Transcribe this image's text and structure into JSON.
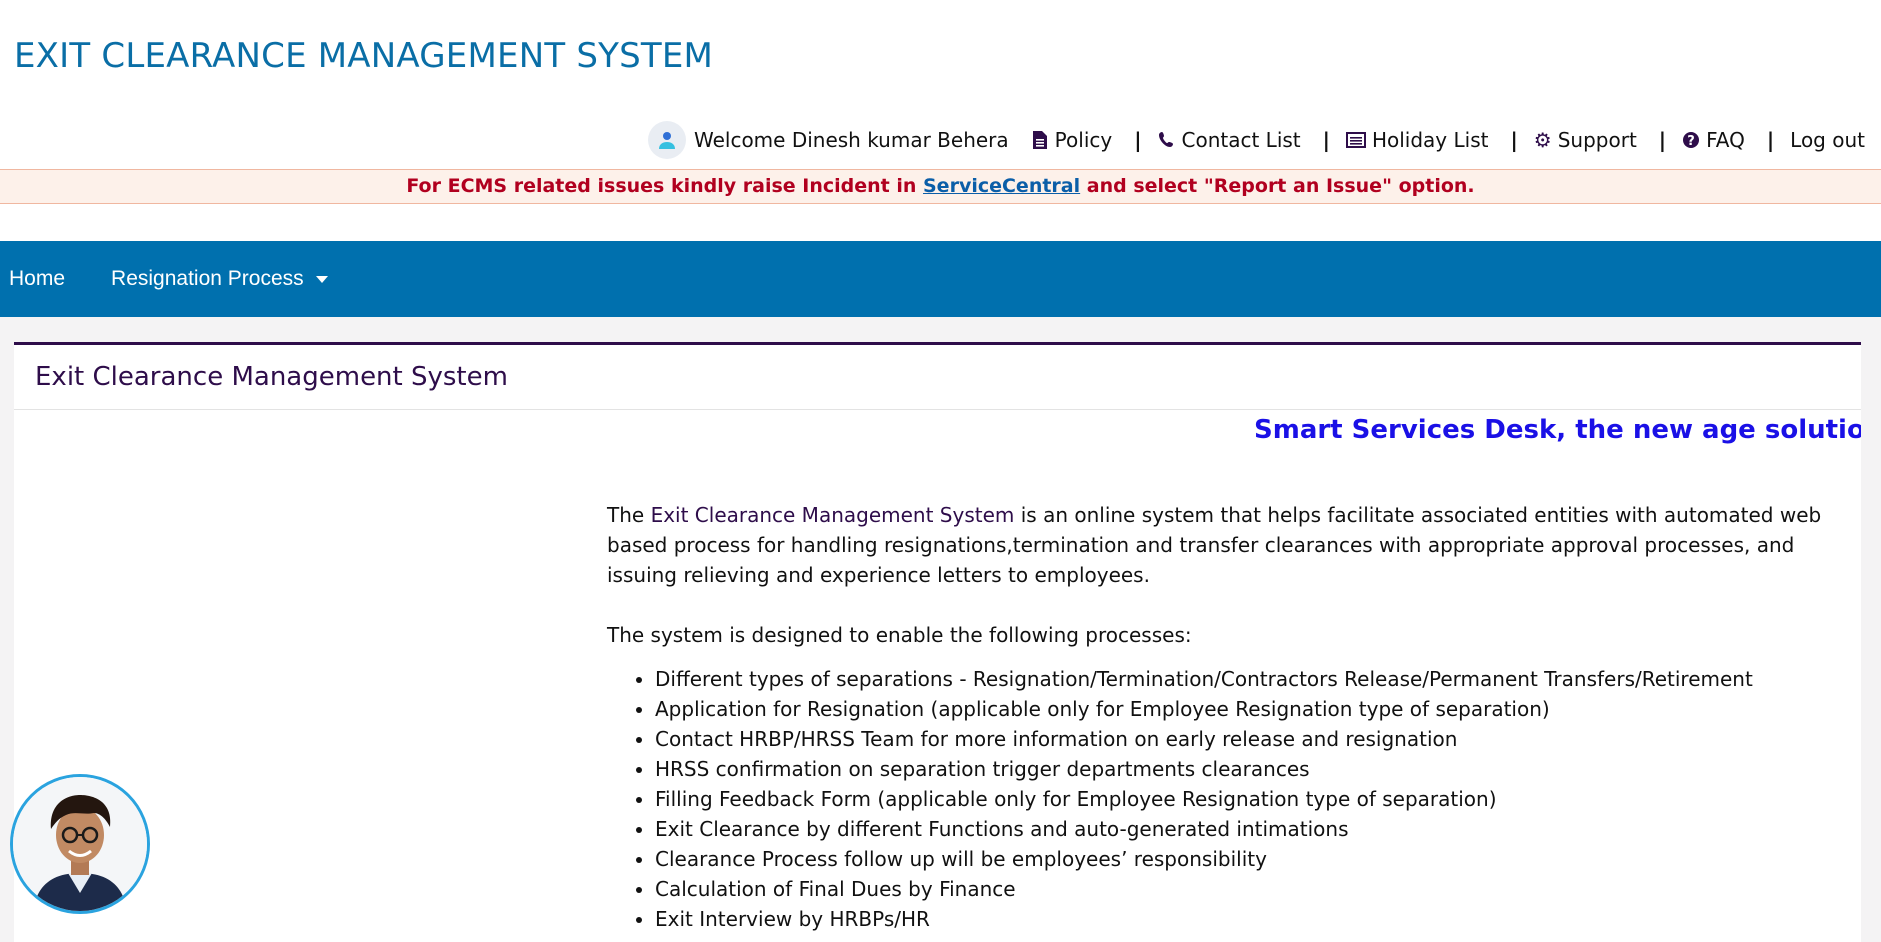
{
  "app": {
    "title": "EXIT CLEARANCE MANAGEMENT SYSTEM"
  },
  "top_links": {
    "welcome": "Welcome Dinesh kumar Behera",
    "items": [
      {
        "label": "Policy",
        "icon": "file-icon"
      },
      {
        "label": "Contact List",
        "icon": "phone-icon"
      },
      {
        "label": "Holiday List",
        "icon": "list-icon"
      },
      {
        "label": "Support",
        "icon": "gear-icon"
      },
      {
        "label": "FAQ",
        "icon": "question-circle-icon"
      },
      {
        "label": "Log out",
        "icon": ""
      }
    ],
    "separator": "|"
  },
  "notice": {
    "prefix": "For ECMS related issues kindly raise Incident in ",
    "link": "ServiceCentral",
    "suffix": " and select \"Report an Issue\" option."
  },
  "nav": {
    "home": "Home",
    "resignation": "Resignation Process"
  },
  "card": {
    "title": "Exit Clearance Management System",
    "marquee": "Smart Services Desk, the new age solution to al",
    "intro_the": "The ",
    "intro_highlight": "Exit Clearance Management System",
    "intro_rest": " is an online system that helps facilitate associated entities with automated web based process for handling resignations,termination and transfer clearances with appropriate approval processes, and issuing relieving and experience letters to employees.",
    "processes_heading": "The system is designed to enable the following processes:",
    "processes": [
      "Different types of separations - Resignation/Termination/Contractors Release/Permanent Transfers/Retirement",
      "Application for Resignation (applicable only for Employee Resignation type of separation)",
      "Contact HRBP/HRSS Team for more information on early release and resignation",
      "HRSS confirmation on separation trigger departments clearances",
      "Filling Feedback Form (applicable only for Employee Resignation type of separation)",
      "Exit Clearance by different Functions and auto-generated intimations",
      "Clearance Process follow up will be employees’ responsibility",
      "Calculation of Final Dues by Finance",
      "Exit Interview by HRBPs/HR"
    ]
  },
  "colors": {
    "brand_blue": "#0070ae",
    "title_blue": "#0a6ea6",
    "notice_red": "#b1001f",
    "marquee_blue": "#1a10e6",
    "dark_purple": "#2e0d4a"
  }
}
